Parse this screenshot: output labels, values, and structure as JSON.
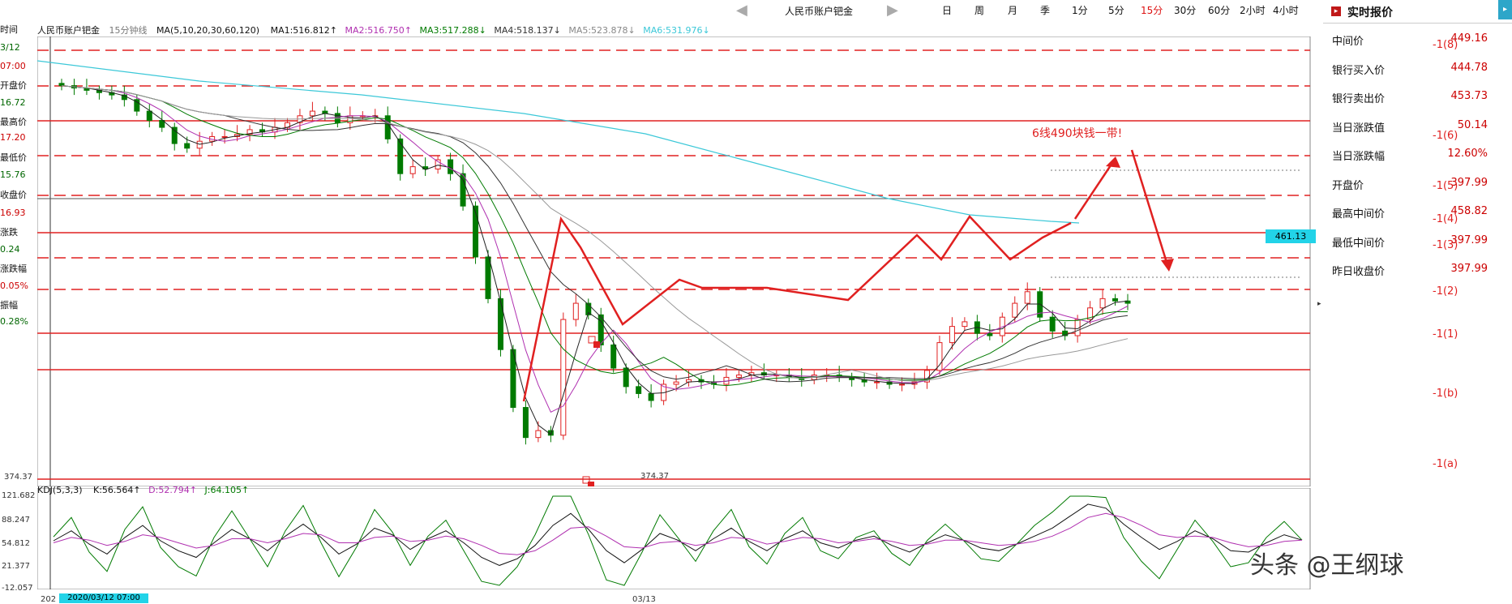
{
  "toolbar": {
    "instrument_tab": "人民币账户钯金",
    "prev_icon": "chevron-left-icon",
    "next_icon": "chevron-right-icon",
    "timeframes": [
      "日",
      "周",
      "月",
      "季",
      "1分",
      "5分",
      "15分",
      "30分",
      "60分",
      "2小时",
      "4小时"
    ],
    "active_timeframe": "15分"
  },
  "chart_header": {
    "instrument": "人民币账户钯金",
    "interval": "15分钟线",
    "ma_param": "MA(5,10,20,30,60,120)",
    "ma1": "MA1:516.812↑",
    "ma2": "MA2:516.750↑",
    "ma3": "MA3:517.288↓",
    "ma4": "MA4:518.137↓",
    "ma5": "MA5:523.878↓",
    "ma6": "MA6:531.976↓"
  },
  "left_panel": {
    "items": [
      {
        "label": "时间",
        "value": "3/12"
      },
      {
        "label": "",
        "value": "07:00"
      },
      {
        "label": "开盘价",
        "value": "16.72"
      },
      {
        "label": "最高价",
        "value": "17.20"
      },
      {
        "label": "最低价",
        "value": "15.76"
      },
      {
        "label": "收盘价",
        "value": "16.93"
      },
      {
        "label": "涨跌",
        "value": "0.24"
      },
      {
        "label": "涨跌幅",
        "value": "0.05%"
      },
      {
        "label": "振幅",
        "value": "0.28%"
      }
    ]
  },
  "right_panel": {
    "title": "实时报价",
    "rows": [
      {
        "label": "中间价",
        "value": "449.16"
      },
      {
        "label": "银行买入价",
        "value": "444.78"
      },
      {
        "label": "银行卖出价",
        "value": "453.73"
      },
      {
        "label": "当日涨跌值",
        "value": "50.14"
      },
      {
        "label": "当日涨跌幅",
        "value": "12.60%"
      },
      {
        "label": "开盘价",
        "value": "397.99"
      },
      {
        "label": "最高中间价",
        "value": "458.82"
      },
      {
        "label": "最低中间价",
        "value": "397.99"
      },
      {
        "label": "昨日收盘价",
        "value": "397.99"
      }
    ]
  },
  "annotations": {
    "note": "6线490块钱一带!",
    "current_price_tag": "461.13",
    "low_label": "374.37",
    "low_axis_label": "374.37",
    "levels": [
      {
        "label": "-1(8)"
      },
      {
        "label": "-1(6)"
      },
      {
        "label": "-1(5)"
      },
      {
        "label": "-1(4)"
      },
      {
        "label": "-1(3)"
      },
      {
        "label": "-1(2)"
      },
      {
        "label": "-1(1)"
      },
      {
        "label": "-1(b)"
      },
      {
        "label": "-1(a)"
      }
    ]
  },
  "kdj": {
    "label": "KDJ(5,3,3)",
    "k": "K:56.564↑",
    "d": "D:52.794↑",
    "j": "J:64.105↑",
    "axis": [
      "121.682",
      "88.247",
      "54.812",
      "21.377",
      "-12.057"
    ]
  },
  "bottom_axis": {
    "start": "202",
    "time_tag": "2020/03/12 07:00",
    "date_tick": "03/13"
  },
  "watermark": "头条 @王纲球",
  "colors": {
    "up": "#e02020",
    "down": "#007a00",
    "ma_cyan": "#3cc8d8",
    "ma_purple": "#b030b0",
    "level_red": "#e02020",
    "tag_cyan": "#22d3e8"
  },
  "chart_data": {
    "type": "candlestick",
    "title": "人民币账户钯金 15分钟线",
    "price_range": [
      374.37,
      560
    ],
    "candles_close": [
      544,
      543,
      542,
      541,
      540,
      538,
      533,
      529,
      526,
      519,
      517,
      520,
      522,
      522,
      523,
      525,
      524,
      526,
      528,
      531,
      533,
      532,
      528,
      531,
      531,
      531,
      521,
      506,
      509,
      508,
      512,
      506,
      492,
      470,
      452,
      430,
      405,
      392,
      395,
      393,
      443,
      450,
      445,
      432,
      422,
      414,
      411,
      408,
      415,
      416,
      417,
      416,
      415,
      418,
      419,
      420,
      419,
      419,
      418,
      417,
      419,
      419,
      418,
      417,
      416,
      416,
      415,
      415,
      416,
      421,
      433,
      440,
      442,
      437,
      436,
      444,
      450,
      455,
      444,
      438,
      436,
      443,
      448,
      452,
      451,
      450
    ],
    "kdj_k": [
      55,
      70,
      50,
      35,
      60,
      78,
      55,
      40,
      30,
      52,
      72,
      58,
      40,
      62,
      80,
      60,
      35,
      50,
      74,
      64,
      42,
      58,
      70,
      52,
      30,
      18,
      28,
      48,
      78,
      96,
      72,
      40,
      22,
      42,
      66,
      56,
      40,
      58,
      74,
      54,
      40,
      58,
      70,
      52,
      44,
      56,
      62,
      48,
      38,
      52,
      64,
      56,
      44,
      40,
      50,
      62,
      74,
      92,
      110,
      104,
      80,
      60,
      42,
      54,
      70,
      58,
      40,
      38,
      52,
      64,
      56
    ],
    "kdj_d": [
      52,
      60,
      56,
      48,
      54,
      64,
      60,
      52,
      44,
      48,
      58,
      58,
      52,
      58,
      66,
      64,
      52,
      52,
      60,
      62,
      54,
      56,
      62,
      58,
      48,
      36,
      34,
      40,
      56,
      74,
      76,
      62,
      46,
      44,
      52,
      54,
      48,
      52,
      60,
      58,
      50,
      54,
      60,
      58,
      52,
      54,
      58,
      54,
      48,
      50,
      56,
      56,
      52,
      48,
      50,
      54,
      62,
      74,
      90,
      96,
      90,
      78,
      64,
      60,
      62,
      60,
      52,
      46,
      48,
      54,
      56
    ]
  }
}
